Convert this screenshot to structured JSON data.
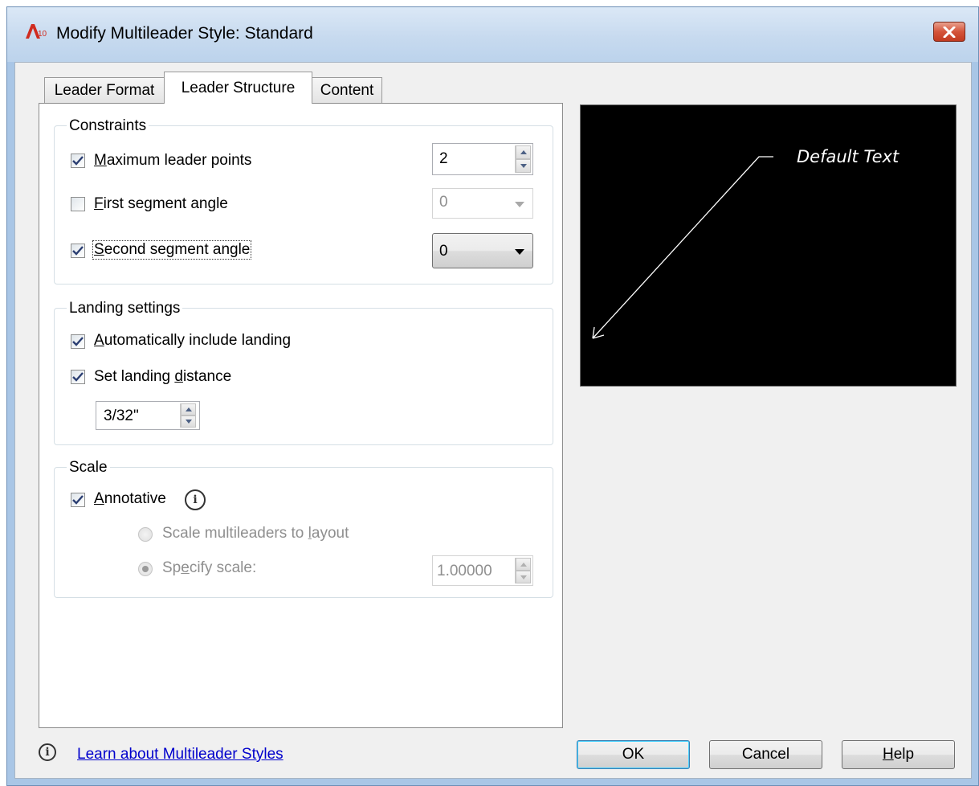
{
  "window": {
    "title": "Modify Multileader Style: Standard",
    "app_icon": "autocad-icon",
    "close_icon": "close-icon"
  },
  "tabs": [
    {
      "label": "Leader Format",
      "selected": false
    },
    {
      "label": "Leader Structure",
      "selected": true
    },
    {
      "label": "Content",
      "selected": false
    }
  ],
  "constraints": {
    "title": "Constraints",
    "max_points": {
      "label_pre": "",
      "label_ul": "M",
      "label_post": "aximum leader points",
      "checked": true,
      "value": "2"
    },
    "first_angle": {
      "label_pre": "",
      "label_ul": "F",
      "label_post": "irst segment angle",
      "checked": false,
      "value": "0",
      "enabled": false
    },
    "second_angle": {
      "label_pre": "",
      "label_ul": "S",
      "label_post": "econd segment angle",
      "checked": true,
      "value": "0"
    }
  },
  "landing": {
    "title": "Landing settings",
    "auto_include": {
      "label_pre": "",
      "label_ul": "A",
      "label_post": "utomatically include landing",
      "checked": true
    },
    "set_distance": {
      "label_pre": "Set landing ",
      "label_ul": "d",
      "label_post": "istance",
      "checked": true
    },
    "distance_value": "3/32\""
  },
  "scale": {
    "title": "Scale",
    "annotative": {
      "label_pre": "",
      "label_ul": "A",
      "label_post": "nnotative",
      "checked": true
    },
    "scale_to_layout": {
      "label_pre": "Scale multileaders to ",
      "label_ul": "l",
      "label_post": "ayout",
      "selected": false,
      "enabled": false
    },
    "specify_scale": {
      "label_pre": "Sp",
      "label_ul": "e",
      "label_post": "cify scale:",
      "selected": true,
      "enabled": false
    },
    "scale_value": "1.00000"
  },
  "preview": {
    "text": "Default Text",
    "background": "#000000"
  },
  "footer": {
    "learn_link": "Learn about Multileader Styles",
    "ok": "OK",
    "cancel": "Cancel",
    "help_ul": "H",
    "help_post": "elp"
  }
}
